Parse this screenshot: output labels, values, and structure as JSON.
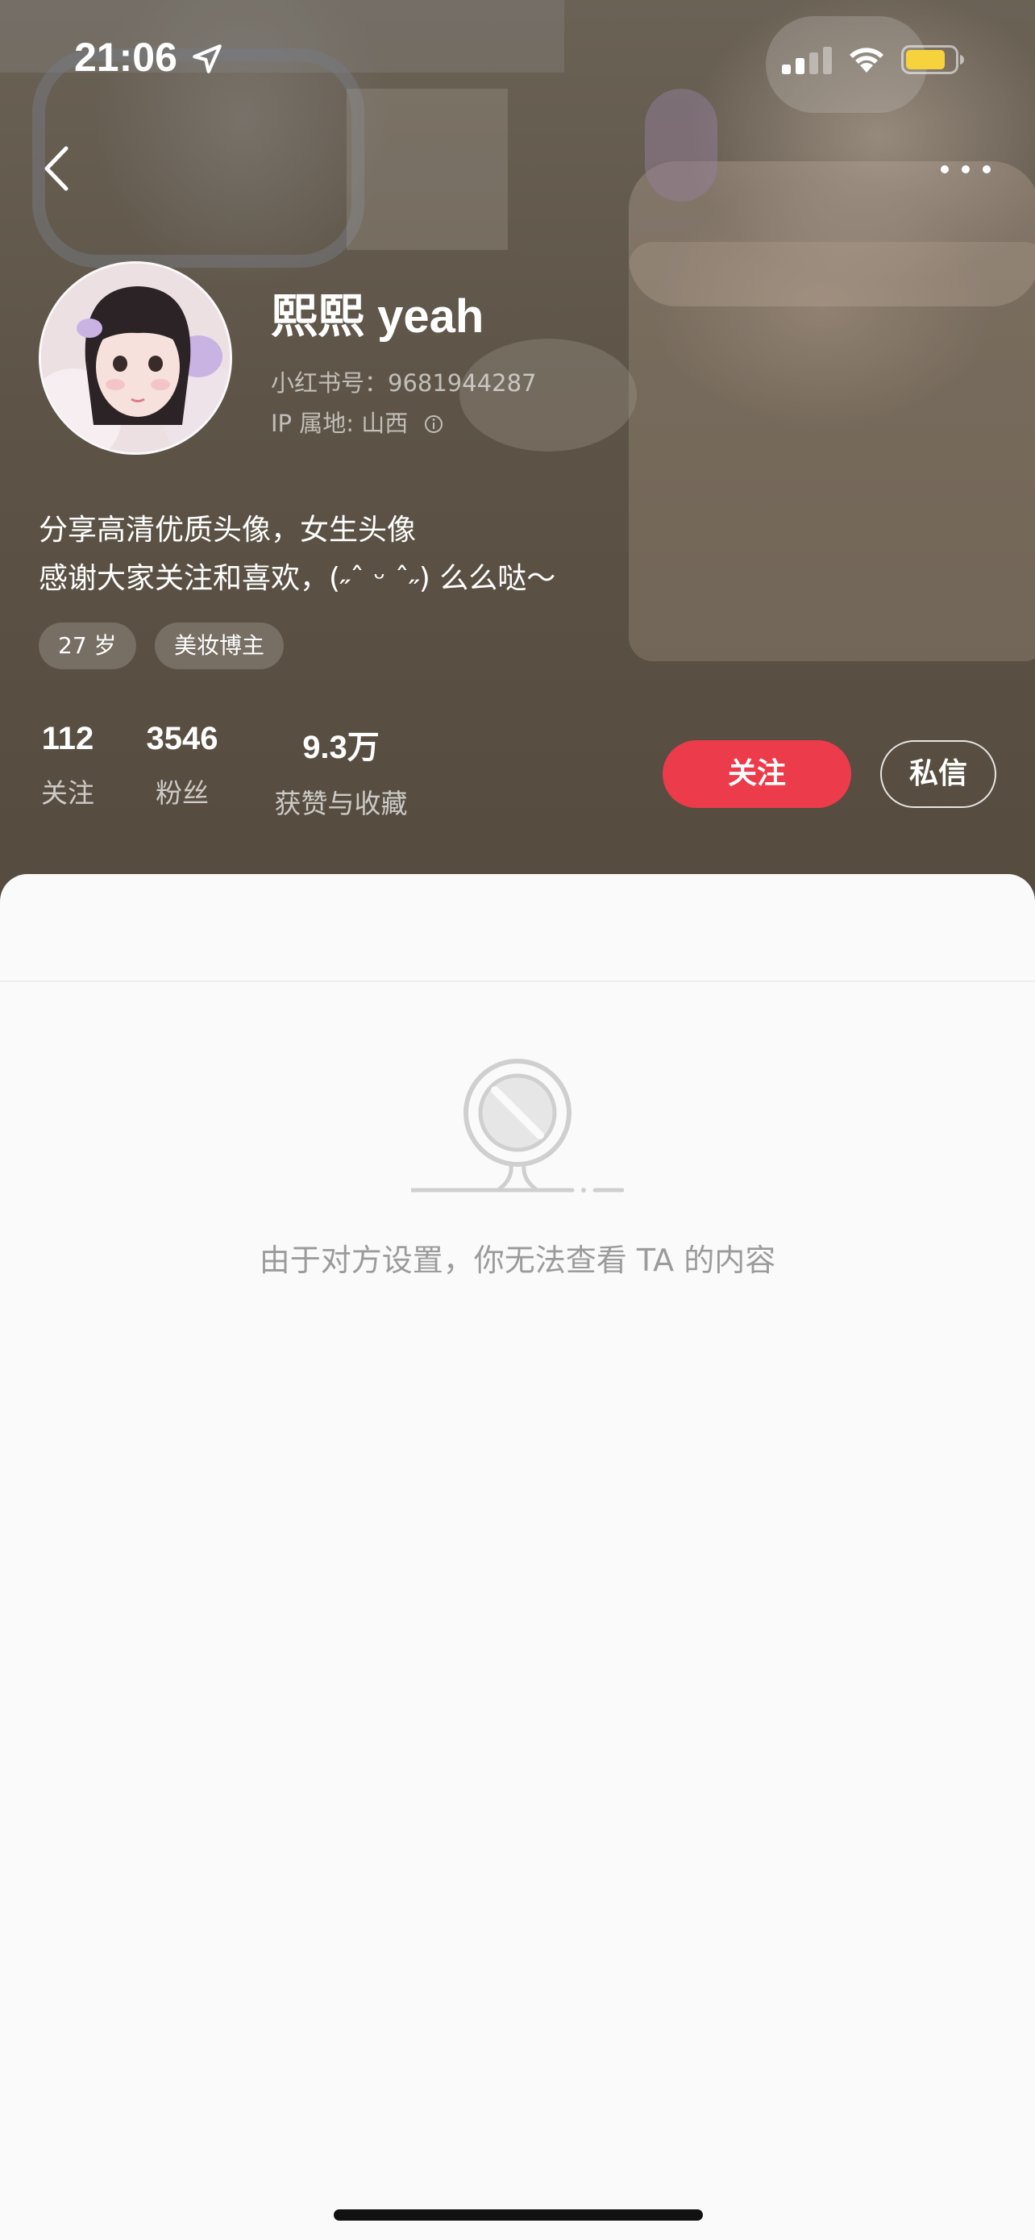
{
  "status_bar": {
    "time": "21:06"
  },
  "profile": {
    "username": "熙熙 yeah",
    "redbook_id": "小红书号：9681944287",
    "ip_location": "IP 属地: 山西",
    "bio_line_1": "分享高清优质头像，女生头像",
    "bio_line_2": "感谢大家关注和喜欢，(˶ˆ ᵕ ˆ˶) 么么哒～",
    "tags": [
      "27 岁",
      "美妆博主"
    ]
  },
  "stats": {
    "following": {
      "value": "112",
      "label": "关注"
    },
    "fans": {
      "value": "3546",
      "label": "粉丝"
    },
    "likes": {
      "value": "9.3万",
      "label": "获赞与收藏"
    }
  },
  "actions": {
    "follow_label": "关注",
    "message_label": "私信"
  },
  "content": {
    "empty_message": "由于对方设置，你无法查看 TA 的内容"
  },
  "colors": {
    "accent": "#ec3b4b",
    "header_bg": "#5d5447",
    "panel_bg": "#fafafa",
    "empty_text": "#9b9b9b"
  },
  "icons": {
    "back": "chevron-left-icon",
    "more": "more-dots-icon",
    "location": "location-arrow-icon",
    "signal": "cellular-signal-icon",
    "wifi": "wifi-icon",
    "battery": "battery-icon",
    "info": "info-icon",
    "empty_state": "blocked-sign-icon"
  }
}
